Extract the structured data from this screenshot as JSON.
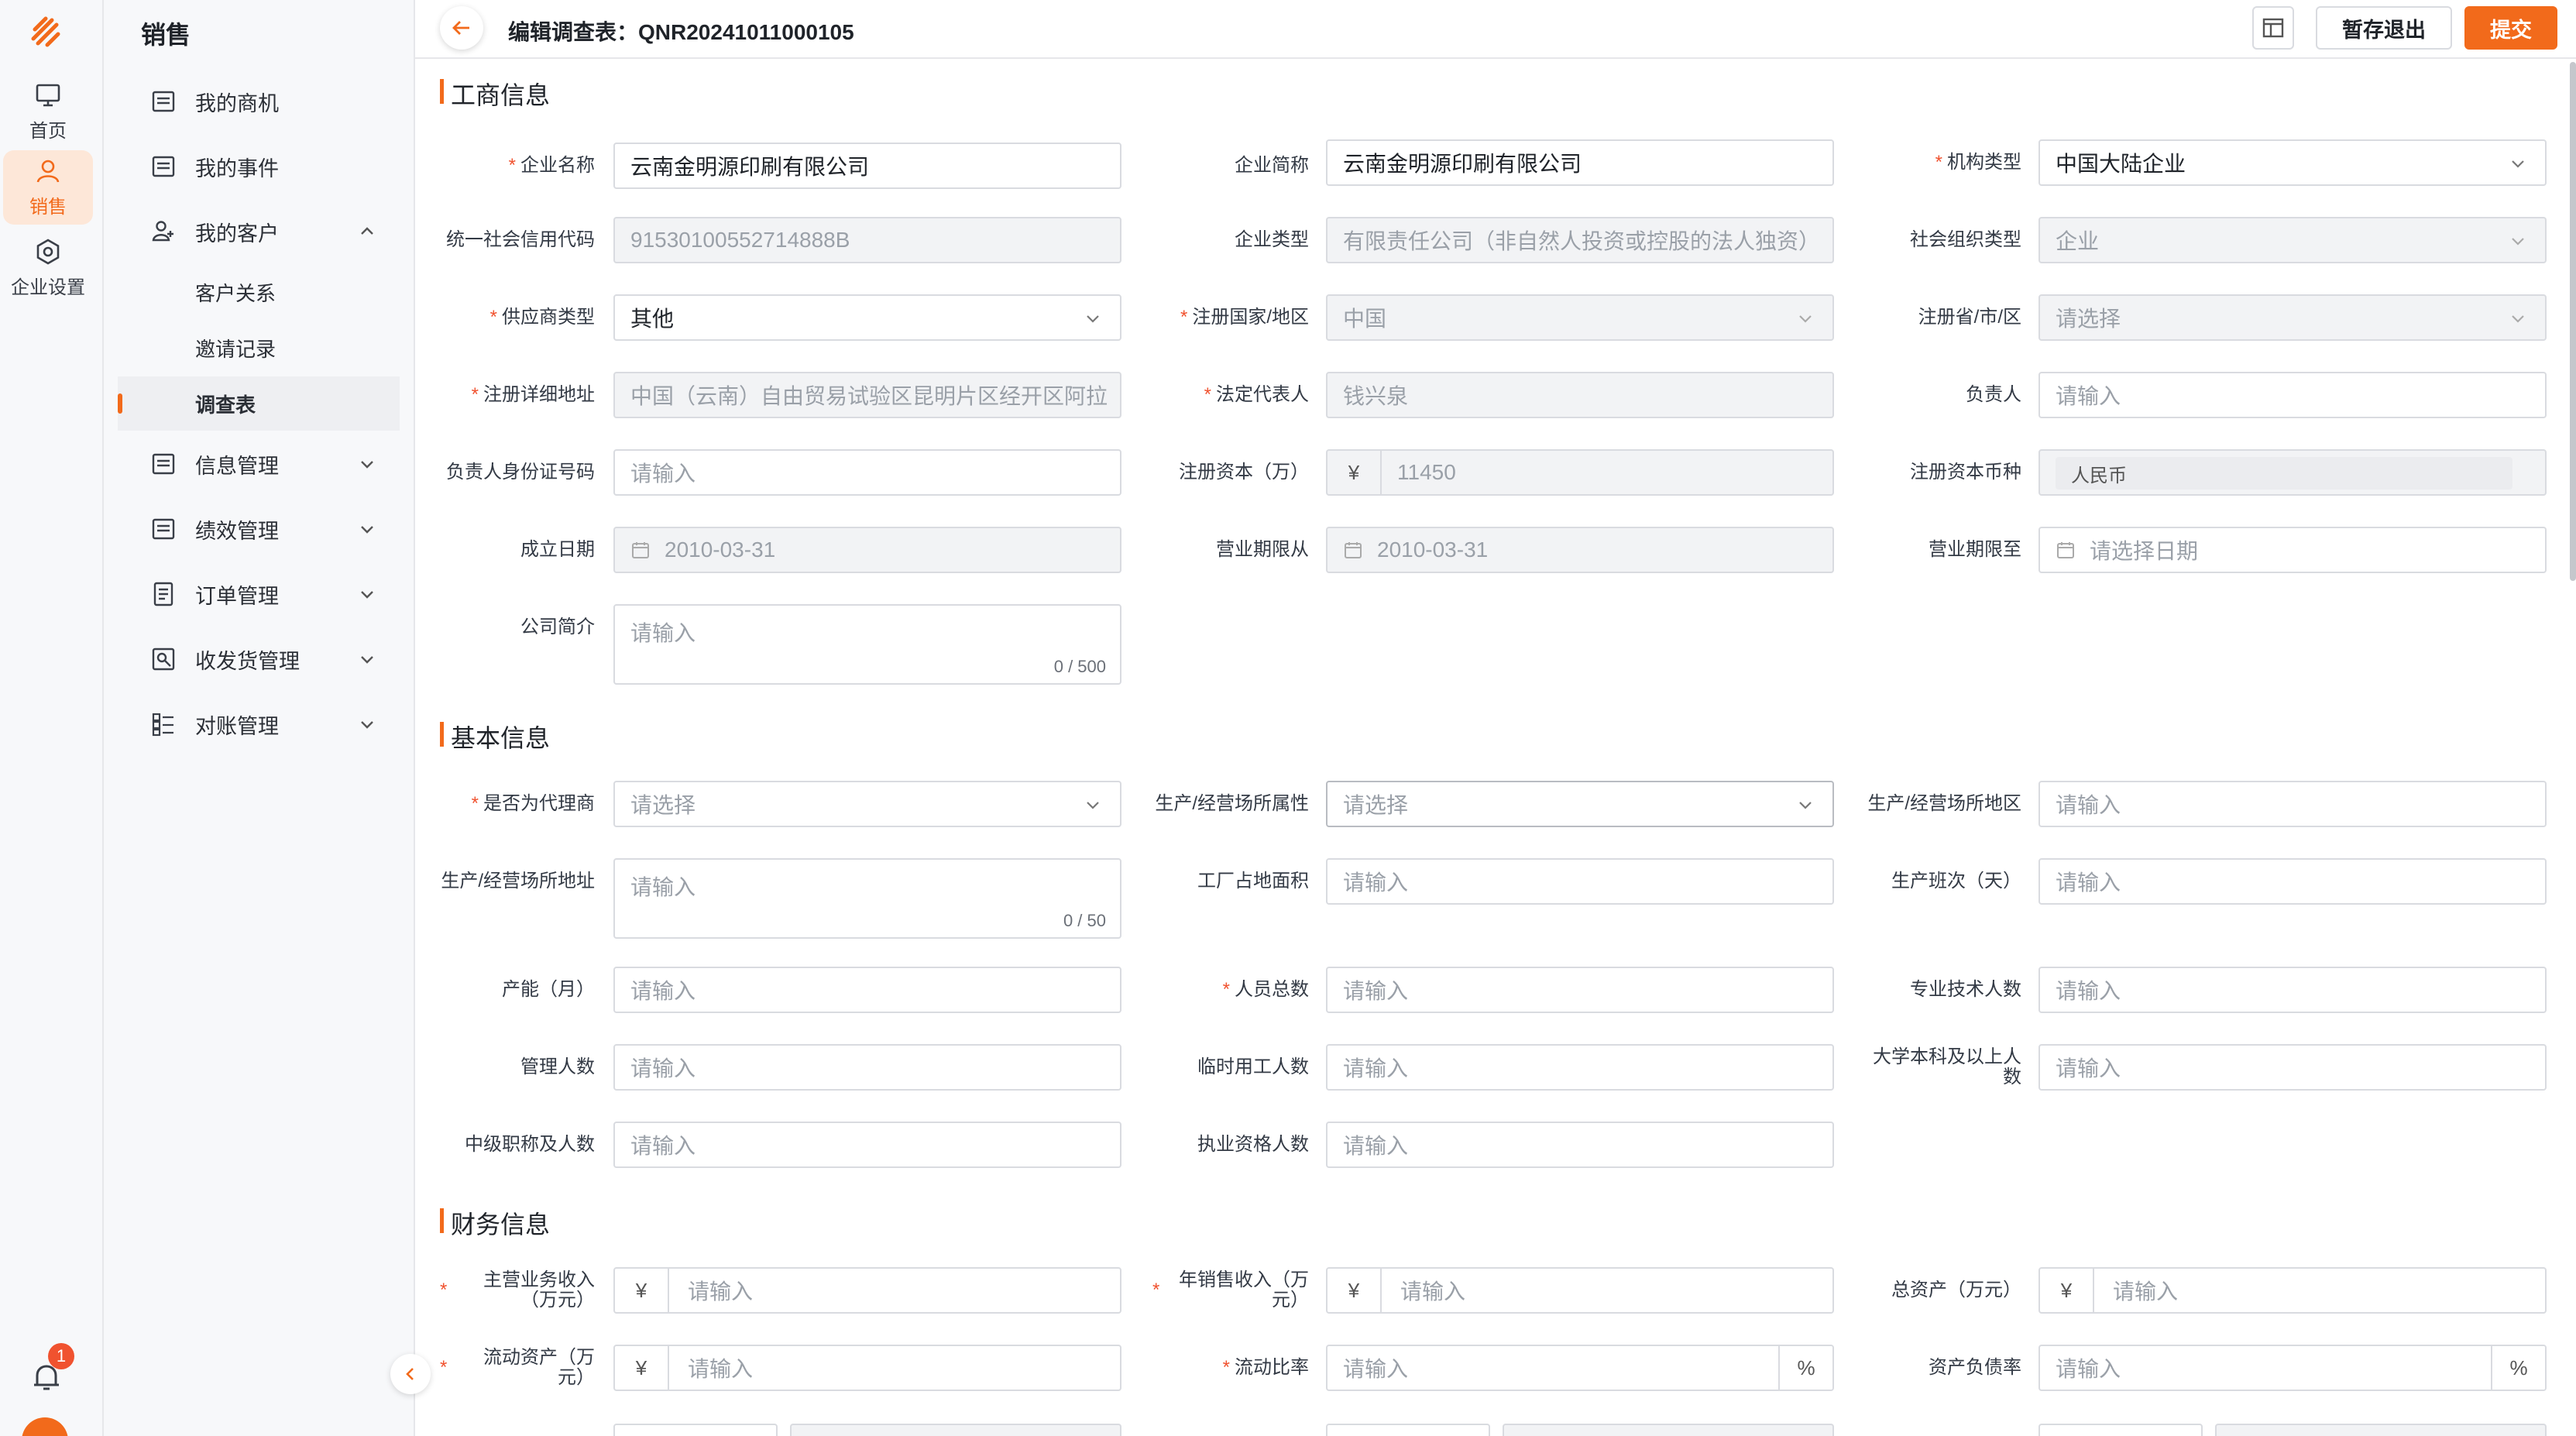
{
  "rail": {
    "items": [
      {
        "label": "首页"
      },
      {
        "label": "销售"
      },
      {
        "label": "企业设置"
      }
    ],
    "notification_count": "1"
  },
  "sidebar": {
    "title": "销售",
    "items": [
      {
        "label": "我的商机"
      },
      {
        "label": "我的事件"
      },
      {
        "label": "我的客户"
      },
      {
        "label": "信息管理"
      },
      {
        "label": "绩效管理"
      },
      {
        "label": "订单管理"
      },
      {
        "label": "收发货管理"
      },
      {
        "label": "对账管理"
      }
    ],
    "sub_items": [
      {
        "label": "客户关系"
      },
      {
        "label": "邀请记录"
      },
      {
        "label": "调查表"
      }
    ]
  },
  "header": {
    "title": "编辑调查表：QNR20241011000105",
    "save_exit_label": "暂存退出",
    "submit_label": "提交"
  },
  "sections": {
    "business": "工商信息",
    "basic": "基本信息",
    "finance": "财务信息"
  },
  "fields": {
    "company_name": {
      "label": "企业名称",
      "value": "云南金明源印刷有限公司"
    },
    "company_short": {
      "label": "企业简称",
      "value": "云南金明源印刷有限公司"
    },
    "org_type": {
      "label": "机构类型",
      "value": "中国大陆企业"
    },
    "credit_code": {
      "label": "统一社会信用代码",
      "value": "91530100552714888B"
    },
    "enterprise_type": {
      "label": "企业类型",
      "value": "有限责任公司（非自然人投资或控股的法人独资）"
    },
    "social_org_type": {
      "label": "社会组织类型",
      "value": "企业"
    },
    "supplier_type": {
      "label": "供应商类型",
      "value": "其他"
    },
    "reg_country": {
      "label": "注册国家/地区",
      "value": "中国"
    },
    "reg_province": {
      "label": "注册省/市/区",
      "placeholder": "请选择"
    },
    "reg_address": {
      "label": "注册详细地址",
      "value": "中国（云南）自由贸易试验区昆明片区经开区阿拉"
    },
    "legal_rep": {
      "label": "法定代表人",
      "value": "钱兴泉"
    },
    "person_in_charge": {
      "label": "负责人",
      "placeholder": "请输入"
    },
    "pic_id": {
      "label": "负责人身份证号码",
      "placeholder": "请输入"
    },
    "reg_capital": {
      "label": "注册资本（万）",
      "prefix": "¥",
      "value": "11450"
    },
    "reg_currency": {
      "label": "注册资本币种",
      "value": "人民币"
    },
    "established": {
      "label": "成立日期",
      "value": "2010-03-31"
    },
    "biz_from": {
      "label": "营业期限从",
      "value": "2010-03-31"
    },
    "biz_to": {
      "label": "营业期限至",
      "placeholder": "请选择日期"
    },
    "intro": {
      "label": "公司简介",
      "placeholder": "请输入",
      "counter": "0 / 500"
    },
    "is_agent": {
      "label": "是否为代理商",
      "placeholder": "请选择"
    },
    "site_attr": {
      "label": "生产/经营场所属性",
      "placeholder": "请选择"
    },
    "site_area": {
      "label": "生产/经营场所地区",
      "placeholder": "请输入"
    },
    "site_address": {
      "label": "生产/经营场所地址",
      "placeholder": "请输入",
      "counter": "0 / 50"
    },
    "factory_area": {
      "label": "工厂占地面积",
      "placeholder": "请输入"
    },
    "shifts": {
      "label": "生产班次（天）",
      "placeholder": "请输入"
    },
    "capacity": {
      "label": "产能（月）",
      "placeholder": "请输入"
    },
    "staff_total": {
      "label": "人员总数",
      "placeholder": "请输入"
    },
    "tech_staff": {
      "label": "专业技术人数",
      "placeholder": "请输入"
    },
    "mgmt_staff": {
      "label": "管理人数",
      "placeholder": "请输入"
    },
    "temp_staff": {
      "label": "临时用工人数",
      "placeholder": "请输入"
    },
    "univ_staff": {
      "label": "大学本科及以上人数",
      "placeholder": "请输入"
    },
    "mid_title": {
      "label": "中级职称及人数",
      "placeholder": "请输入"
    },
    "qualified": {
      "label": "执业资格人数",
      "placeholder": "请输入"
    },
    "main_revenue": {
      "label": "主营业务收入（万元）",
      "prefix": "¥",
      "placeholder": "请输入"
    },
    "annual_sales": {
      "label": "年销售收入（万元）",
      "prefix": "¥",
      "placeholder": "请输入"
    },
    "total_assets": {
      "label": "总资产（万元）",
      "prefix": "¥",
      "placeholder": "请输入"
    },
    "current_assets": {
      "label": "流动资产（万元）",
      "prefix": "¥",
      "placeholder": "请输入"
    },
    "current_ratio": {
      "label": "流动比率",
      "suffix": "%",
      "placeholder": "请输入"
    },
    "debt_ratio": {
      "label": "资产负债率",
      "suffix": "%",
      "placeholder": "请输入"
    }
  },
  "colors": {
    "accent": "#F26A1B",
    "required": "#f0522f"
  }
}
